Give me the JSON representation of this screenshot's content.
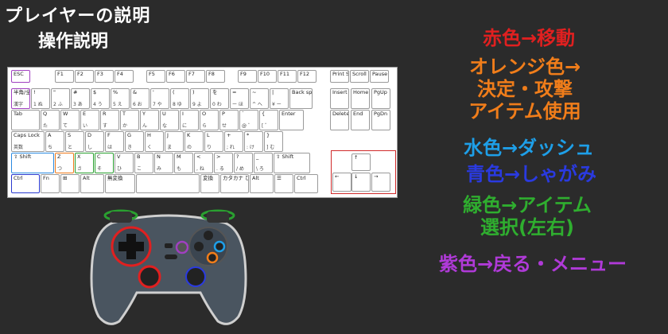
{
  "header": {
    "title": "プレイヤーの説明",
    "subtitle": "操作説明"
  },
  "keyboard": {
    "row0": [
      "ESC",
      "F1",
      "F2",
      "F3",
      "F4",
      "F5",
      "F6",
      "F7",
      "F8",
      "F9",
      "F10",
      "F11",
      "F12",
      "Print Screen",
      "Scroll Lock",
      "Pause Break"
    ],
    "row1": [
      {
        "t": "半角/全角",
        "s": "漢字"
      },
      {
        "t": "!",
        "s": "1 ぬ"
      },
      {
        "t": "\"",
        "s": "2 ふ"
      },
      {
        "t": "#",
        "s": "3 あ"
      },
      {
        "t": "$",
        "s": "4 う"
      },
      {
        "t": "%",
        "s": "5 え"
      },
      {
        "t": "&",
        "s": "6 お"
      },
      {
        "t": "'",
        "s": "7 や"
      },
      {
        "t": "(",
        "s": "8 ゆ"
      },
      {
        "t": ")",
        "s": "9 よ"
      },
      {
        "t": "を",
        "s": "0 わ"
      },
      {
        "t": "=",
        "s": "ー ほ"
      },
      {
        "t": "~",
        "s": "^ へ"
      },
      {
        "t": "|",
        "s": "¥ ー"
      },
      {
        "t": "Back space",
        "s": ""
      }
    ],
    "row1_right": [
      "Insert",
      "Home",
      "PgUp"
    ],
    "row2": [
      {
        "t": "Tab",
        "s": ""
      },
      {
        "t": "Q",
        "s": "た"
      },
      {
        "t": "W",
        "s": "て"
      },
      {
        "t": "E",
        "s": "い"
      },
      {
        "t": "R",
        "s": "す"
      },
      {
        "t": "T",
        "s": "か"
      },
      {
        "t": "Y",
        "s": "ん"
      },
      {
        "t": "U",
        "s": "な"
      },
      {
        "t": "I",
        "s": "に"
      },
      {
        "t": "O",
        "s": "ら"
      },
      {
        "t": "P",
        "s": "せ"
      },
      {
        "t": "`",
        "s": "@ ゛"
      },
      {
        "t": "{",
        "s": "[ ゜"
      },
      {
        "t": "Enter",
        "s": ""
      }
    ],
    "row2_right": [
      "Delete",
      "End",
      "PgDn"
    ],
    "row3": [
      {
        "t": "Caps Lock",
        "s": "英数"
      },
      {
        "t": "A",
        "s": "ち"
      },
      {
        "t": "S",
        "s": "と"
      },
      {
        "t": "D",
        "s": "し"
      },
      {
        "t": "F",
        "s": "は"
      },
      {
        "t": "G",
        "s": "き"
      },
      {
        "t": "H",
        "s": "く"
      },
      {
        "t": "J",
        "s": "ま"
      },
      {
        "t": "K",
        "s": "の"
      },
      {
        "t": "L",
        "s": "り"
      },
      {
        "t": "+",
        "s": "; れ"
      },
      {
        "t": "*",
        "s": ": け"
      },
      {
        "t": "}",
        "s": "] む"
      }
    ],
    "row4": [
      {
        "t": "⇧ Shift",
        "s": ""
      },
      {
        "t": "Z",
        "s": "つ"
      },
      {
        "t": "X",
        "s": "さ"
      },
      {
        "t": "C",
        "s": "そ"
      },
      {
        "t": "V",
        "s": "ひ"
      },
      {
        "t": "B",
        "s": "こ"
      },
      {
        "t": "N",
        "s": "み"
      },
      {
        "t": "M",
        "s": "も"
      },
      {
        "t": "<",
        "s": ", ね"
      },
      {
        "t": ">",
        "s": ". る"
      },
      {
        "t": "?",
        "s": "/ め"
      },
      {
        "t": "_",
        "s": "\\ ろ"
      },
      {
        "t": "⇧ Shift",
        "s": ""
      }
    ],
    "row5": [
      "Ctrl",
      "Fn",
      "⊞",
      "Alt",
      "無変換",
      "",
      "変換",
      "カタカナ ひらがな ローマ字",
      "Alt",
      "☰",
      "Ctrl"
    ],
    "arrows": [
      "↑",
      "←",
      "↓",
      "→"
    ]
  },
  "legend": [
    {
      "text": "赤色→移動",
      "color": "#e02020"
    },
    {
      "text": "オレンジ色→\n決定・攻撃\nアイテム使用",
      "color": "#f07d1a"
    },
    {
      "text": "水色→ダッシュ",
      "color": "#1e9fe8"
    },
    {
      "text": "青色→しゃがみ",
      "color": "#2a3ae0"
    },
    {
      "text": "緑色→アイテム\n選択(左右)",
      "color": "#2fae2f"
    },
    {
      "text": "紫色→戻る・メニュー",
      "color": "#b03ad8"
    }
  ],
  "icons": {
    "controller": "gamepad-icon"
  }
}
